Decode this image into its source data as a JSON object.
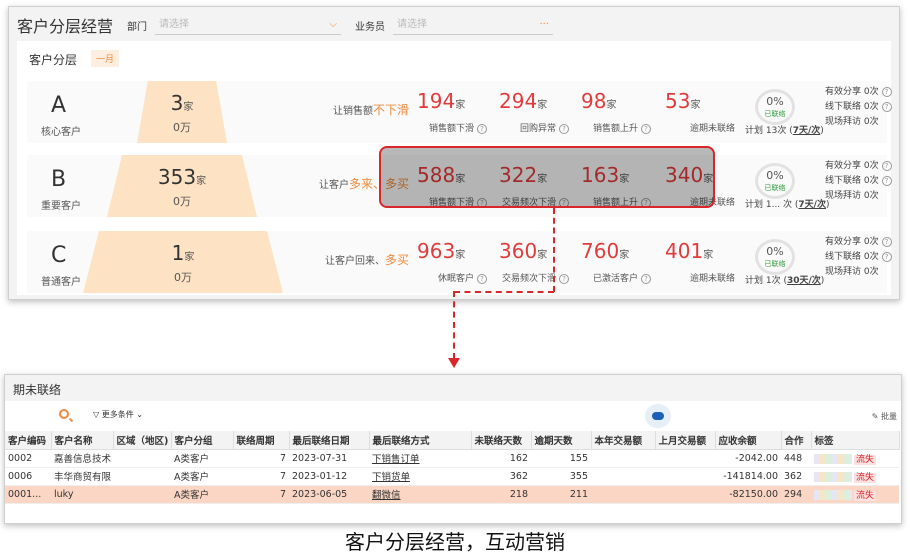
{
  "dashboard": {
    "title": "客户分层经营",
    "filters": [
      {
        "label": "部门",
        "placeholder": "请选择"
      },
      {
        "label": "业务员",
        "placeholder": "请选择"
      }
    ],
    "segment_title": "客户分层",
    "period_badge": "一月",
    "rows": [
      {
        "grade": "A",
        "grade_name": "核心客户",
        "count": "3",
        "count_unit": "家",
        "amount": "0万",
        "action_prefix": "让销售额",
        "action_highlight": "不下滑",
        "metrics": [
          {
            "value": "194",
            "unit": "家",
            "label": "销售额下滑"
          },
          {
            "value": "294",
            "unit": "家",
            "label": "回购异常"
          },
          {
            "value": "98",
            "unit": "家",
            "label": "销售额上升"
          },
          {
            "value": "53",
            "unit": "家",
            "label": "逾期未联络"
          }
        ],
        "gauge_pct": "0%",
        "gauge_sub": "已联络",
        "plan_prefix": "计划 13次",
        "plan_rate": "7天/次",
        "stats": [
          "有效分享 0次",
          "线下联络 0次",
          "现场拜访 0次"
        ]
      },
      {
        "grade": "B",
        "grade_name": "重要客户",
        "count": "353",
        "count_unit": "家",
        "amount": "0万",
        "action_prefix": "让客户",
        "action_highlight": "多来、多买",
        "metrics": [
          {
            "value": "588",
            "unit": "家",
            "label": "销售额下滑"
          },
          {
            "value": "322",
            "unit": "家",
            "label": "交易频次下滑"
          },
          {
            "value": "163",
            "unit": "家",
            "label": "销售额上升"
          },
          {
            "value": "340",
            "unit": "家",
            "label": "逾期未联络"
          }
        ],
        "gauge_pct": "0%",
        "gauge_sub": "已联络",
        "plan_prefix": "计划 1... 次",
        "plan_rate": "7天/次",
        "stats": [
          "有效分享 0次",
          "线下联络 0次",
          "现场拜访 0次"
        ]
      },
      {
        "grade": "C",
        "grade_name": "普通客户",
        "count": "1",
        "count_unit": "家",
        "amount": "0万",
        "action_prefix": "让客户回来、",
        "action_highlight": "多买",
        "metrics": [
          {
            "value": "963",
            "unit": "家",
            "label": "休眠客户"
          },
          {
            "value": "360",
            "unit": "家",
            "label": "交易频次下滑"
          },
          {
            "value": "760",
            "unit": "家",
            "label": "已激活客户"
          },
          {
            "value": "401",
            "unit": "家",
            "label": "逾期未联络"
          }
        ],
        "gauge_pct": "0%",
        "gauge_sub": "已联络",
        "plan_prefix": "计划 1次",
        "plan_rate": "30天/次",
        "stats": [
          "有效分享 0次",
          "线下联络 0次",
          "现场拜访 0次"
        ]
      }
    ]
  },
  "table_panel": {
    "title": "期未联络",
    "more_filters": "更多条件",
    "batch": "批量",
    "columns": [
      "客户编码",
      "客户名称",
      "区域（地区)",
      "客户分组",
      "联络周期",
      "最后联络日期",
      "最后联络方式",
      "未联络天数",
      "逾期天数",
      "本年交易额",
      "上月交易额",
      "应收余额",
      "合作",
      "标签"
    ],
    "rows": [
      {
        "code": "0002",
        "name": "嘉善信息技术",
        "region": "",
        "group": "A类客户",
        "cycle": "7",
        "last_date": "2023-07-31",
        "method": "下销售订单",
        "days": "162",
        "overdue": "155",
        "year_amt": "",
        "month_amt": "",
        "receivable": "-2042.00",
        "coop": "448",
        "tag": "流失"
      },
      {
        "code": "0006",
        "name": "丰华商贸有限",
        "region": "",
        "group": "A类客户",
        "cycle": "7",
        "last_date": "2023-01-12",
        "method": "下销货单",
        "days": "362",
        "overdue": "355",
        "year_amt": "",
        "month_amt": "",
        "receivable": "-141814.00",
        "coop": "362",
        "tag": "流失"
      },
      {
        "code": "0001...",
        "name": "luky",
        "region": "",
        "group": "A类客户",
        "cycle": "7",
        "last_date": "2023-06-05",
        "method": "翻微信",
        "days": "218",
        "overdue": "211",
        "year_amt": "",
        "month_amt": "",
        "receivable": "-82150.00",
        "coop": "294",
        "tag": "流失"
      }
    ]
  },
  "caption": "客户分层经营，互动营销",
  "colors": {
    "accent": "#f08a3c",
    "alert_red": "#e23b3b",
    "highlight_border": "#d9262a",
    "contacted_green": "#2c9a3a"
  }
}
